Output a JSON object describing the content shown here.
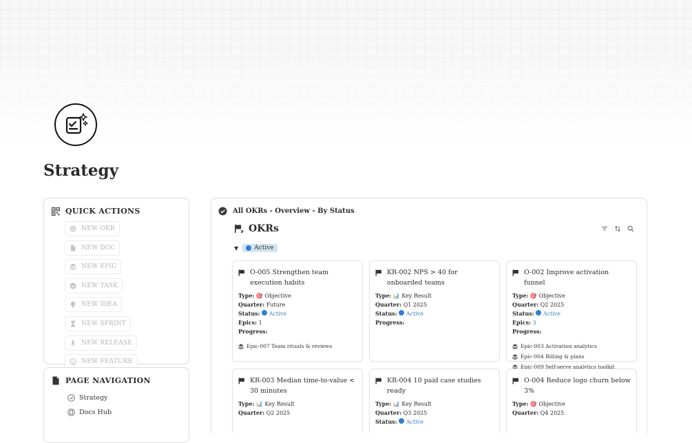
{
  "page": {
    "title": "Strategy"
  },
  "quick_actions": {
    "heading": "QUICK ACTIONS",
    "items": [
      {
        "label": "NEW OKR",
        "icon": "target-icon"
      },
      {
        "label": "NEW DOC",
        "icon": "document-icon"
      },
      {
        "label": "NEW EPIC",
        "icon": "stack-icon"
      },
      {
        "label": "NEW TASK",
        "icon": "check-circle-icon"
      },
      {
        "label": "NEW IDEA",
        "icon": "lightbulb-icon"
      },
      {
        "label": "NEW SPRINT",
        "icon": "hourglass-icon"
      },
      {
        "label": "NEW RELEASE",
        "icon": "rocket-icon"
      },
      {
        "label": "NEW FEATURE",
        "icon": "smile-icon"
      }
    ]
  },
  "page_navigation": {
    "heading": "PAGE NAVIGATION",
    "items": [
      {
        "label": "Strategy",
        "icon": "strategy-icon"
      },
      {
        "label": "Docs Hub",
        "icon": "docs-hub-icon"
      }
    ]
  },
  "okr_view": {
    "view_label": "All OKRs - Overview - By Status",
    "database_title": "OKRs",
    "group": {
      "status": "Active",
      "color": "#2f7fd4"
    },
    "cards": [
      {
        "title": "O-005 Strengthen team execution habits",
        "type": "🎯 Objective",
        "quarter": "Future",
        "status": "Active",
        "epics": "1",
        "epic_items": [
          "Epic-007 Team rituals & reviews"
        ]
      },
      {
        "title": "KR-002 NPS > 40 for onboarded teams",
        "type": "📊 Key Result",
        "quarter": "Q1 2025",
        "status": "Active"
      },
      {
        "title": "O-002 Improve activation funnel",
        "type": "🎯 Objective",
        "quarter": "Q2 2025",
        "status": "Active",
        "epics": "3",
        "epic_items": [
          "Epic-003 Activation analytics",
          "Epic-004 Billing & plans",
          "Epic-009 Self-serve analytics toolkit"
        ]
      },
      {
        "title": "KR-003 Median time-to-value < 30 minutes",
        "type": "📊 Key Result",
        "quarter": "Q2 2025"
      },
      {
        "title": "KR-004 10 paid case studies ready",
        "type": "📊 Key Result",
        "quarter": "Q3 2025",
        "status": "Active"
      },
      {
        "title": "O-004 Reduce logo churn below 3%",
        "type": "🎯 Objective",
        "quarter": "Q4 2025"
      }
    ],
    "prop_labels": {
      "type": "Type:",
      "quarter": "Quarter:",
      "status": "Status:",
      "epics": "Epics:",
      "progress": "Progress:"
    }
  },
  "colors": {
    "status_active": "#2f7fd4",
    "pill_bg": "#d3e5ef"
  }
}
